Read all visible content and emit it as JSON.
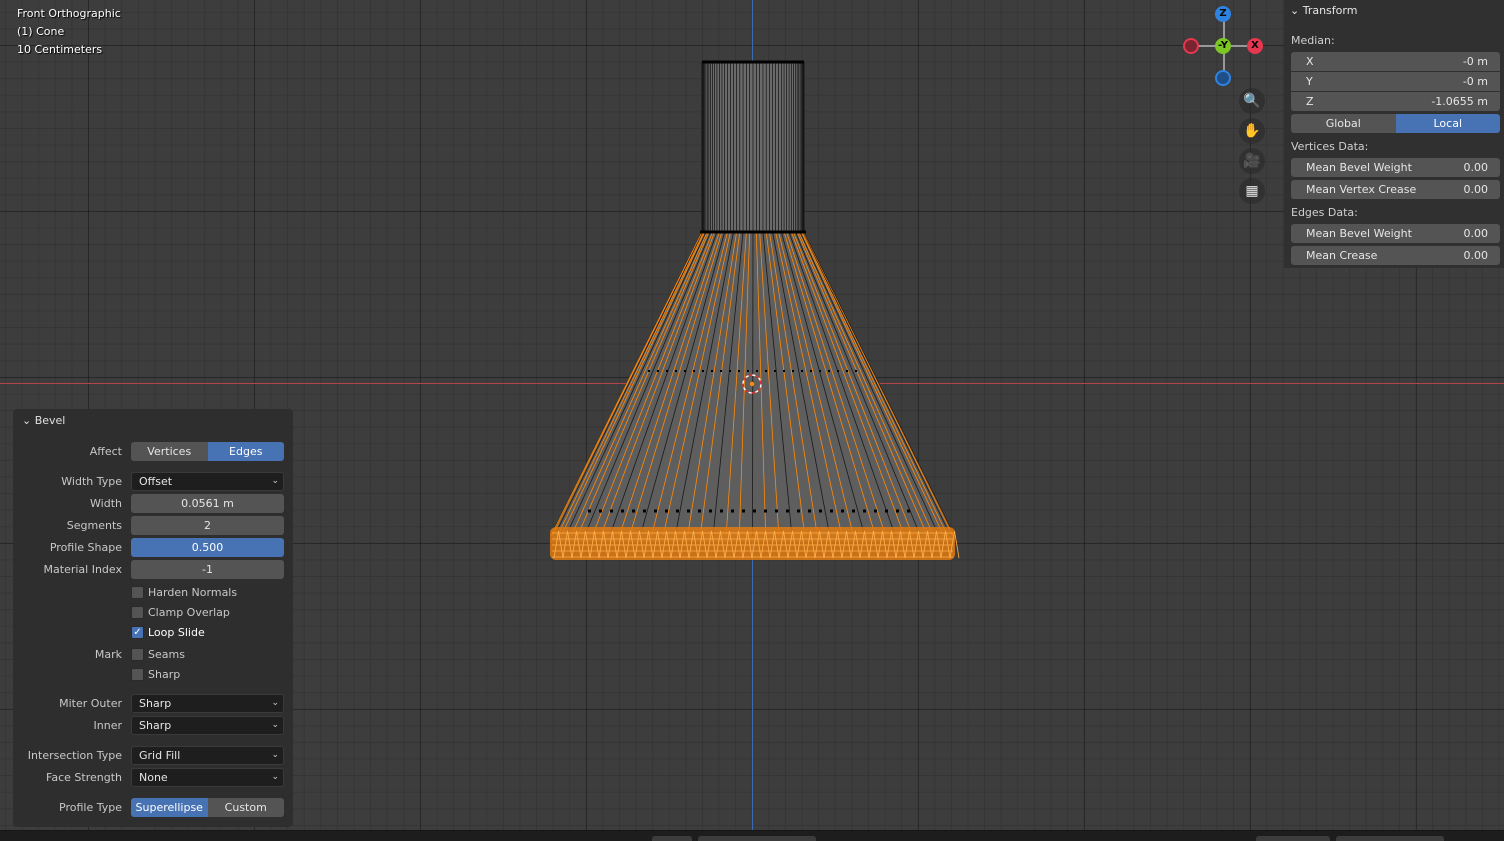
{
  "viewport": {
    "view_name": "Front Orthographic",
    "object_name": "(1) Cone",
    "scale_label": "10 Centimeters"
  },
  "gizmo": {
    "z_label": "Z",
    "y_label": "-Y",
    "x_label": "X",
    "nav_icons": [
      "zoom-icon",
      "hand-icon",
      "camera-icon",
      "grid-icon"
    ]
  },
  "npanel": {
    "header": "Transform",
    "median_label": "Median:",
    "median": [
      {
        "label": "X",
        "value": "-0 m"
      },
      {
        "label": "Y",
        "value": "-0 m"
      },
      {
        "label": "Z",
        "value": "-1.0655 m"
      }
    ],
    "space_options": [
      "Global",
      "Local"
    ],
    "space_selected": "Local",
    "vertices_label": "Vertices Data:",
    "vertices": [
      {
        "label": "Mean Bevel Weight",
        "value": "0.00"
      },
      {
        "label": "Mean Vertex Crease",
        "value": "0.00"
      }
    ],
    "edges_label": "Edges Data:",
    "edges": [
      {
        "label": "Mean Bevel Weight",
        "value": "0.00"
      },
      {
        "label": "Mean Crease",
        "value": "0.00"
      }
    ]
  },
  "bevel": {
    "title": "Bevel",
    "affect_label": "Affect",
    "affect_options": [
      "Vertices",
      "Edges"
    ],
    "affect_selected": "Edges",
    "width_type_label": "Width Type",
    "width_type": "Offset",
    "width_label": "Width",
    "width": "0.0561 m",
    "segments_label": "Segments",
    "segments": "2",
    "profile_shape_label": "Profile Shape",
    "profile_shape": "0.500",
    "material_index_label": "Material Index",
    "material_index": "-1",
    "harden_normals": {
      "label": "Harden Normals",
      "checked": false
    },
    "clamp_overlap": {
      "label": "Clamp Overlap",
      "checked": false
    },
    "loop_slide": {
      "label": "Loop Slide",
      "checked": true
    },
    "mark_label": "Mark",
    "seams": {
      "label": "Seams",
      "checked": false
    },
    "sharp": {
      "label": "Sharp",
      "checked": false
    },
    "miter_outer_label": "Miter Outer",
    "miter_outer": "Sharp",
    "inner_label": "Inner",
    "inner": "Sharp",
    "intersection_type_label": "Intersection Type",
    "intersection_type": "Grid Fill",
    "face_strength_label": "Face Strength",
    "face_strength": "None",
    "profile_type_label": "Profile Type",
    "profile_type_options": [
      "Superellipse",
      "Custom"
    ],
    "profile_type_selected": "Superellipse"
  },
  "colors": {
    "selection": "#ff8a0a",
    "accent": "#4772b3",
    "axis_x": "#b4444c",
    "axis_z": "#3b6bb0",
    "gizmo_x": "#e5374f",
    "gizmo_y": "#7cc724",
    "gizmo_z": "#2f83e0"
  }
}
